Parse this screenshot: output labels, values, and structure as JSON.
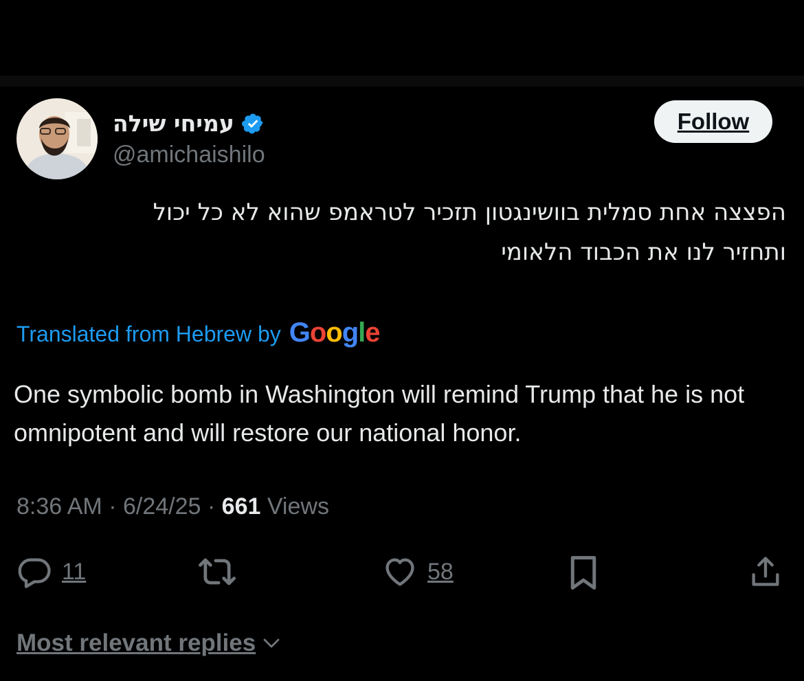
{
  "author": {
    "display_name": "עמיחי שילה",
    "handle": "@amichaishilo",
    "verified_icon": "verified-badge-icon"
  },
  "follow_button": {
    "label": "Follow"
  },
  "post": {
    "hebrew_line_1": "הפצצה אחת סמלית בוושינגטון תזכיר לטראמפ שהוא לא כל יכול",
    "hebrew_line_2": "ותחזיר לנו את הכבוד הלאומי",
    "translated_label": "Translated from Hebrew by",
    "translation_provider": "Google",
    "translation_text": "One symbolic bomb in Washington will remind Trump that he is not omnipotent and will restore our national honor."
  },
  "meta": {
    "time": "8:36 AM",
    "date": "6/24/25",
    "separator": "·",
    "views_count": "661",
    "views_label": "Views"
  },
  "actions": {
    "reply_count": "11",
    "like_count": "58"
  },
  "replies": {
    "sort_label": "Most relevant replies"
  },
  "colors": {
    "background": "#000000",
    "text_primary": "#e7e9ea",
    "text_secondary": "#71767b",
    "accent": "#1d9bf0",
    "follow_bg": "#eff3f4"
  }
}
